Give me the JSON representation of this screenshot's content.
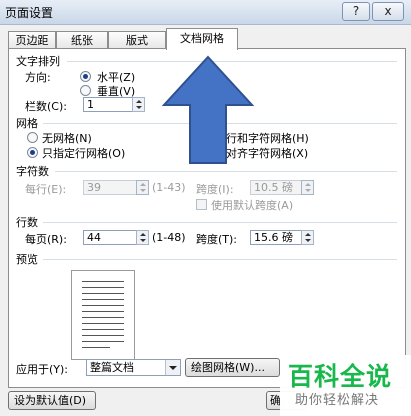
{
  "window": {
    "title": "页面设置",
    "help_label": "?",
    "close_label": "x"
  },
  "tabs": [
    "页边距",
    "纸张",
    "版式",
    "文档网格"
  ],
  "text_direction": {
    "section_title": "文字排列",
    "direction_label": "方向:",
    "options": [
      "水平(Z)",
      "垂直(V)"
    ],
    "selected": "水平(Z)",
    "columns_label": "栏数(C):",
    "columns_value": "1"
  },
  "grid": {
    "section_title": "网格",
    "options": [
      "无网格(N)",
      "只指定行网格(O)",
      "指定行和字符网格(H)",
      "文字对齐字符网格(X)"
    ],
    "selected": "只指定行网格(O)"
  },
  "characters": {
    "section_title": "字符数",
    "per_line_label": "每行(E):",
    "per_line_value": "39",
    "per_line_range": "(1-43)",
    "pitch_label": "跨度(I):",
    "pitch_value": "10.5 磅",
    "default_pitch_label": "使用默认跨度(A)"
  },
  "lines": {
    "section_title": "行数",
    "per_page_label": "每页(R):",
    "per_page_value": "44",
    "per_page_range": "(1-48)",
    "pitch_label": "跨度(T):",
    "pitch_value": "15.6 磅"
  },
  "preview": {
    "section_title": "预览"
  },
  "footer": {
    "apply_label": "应用于(Y):",
    "apply_value": "整篇文档",
    "draw_grid_label": "绘图网格(W)...",
    "set_default_label": "设为默认值(D)",
    "ok_label": "确"
  },
  "watermark": {
    "logo": "百科全说",
    "sub": "助你轻松解决"
  },
  "arrow_color": "#4472c4"
}
